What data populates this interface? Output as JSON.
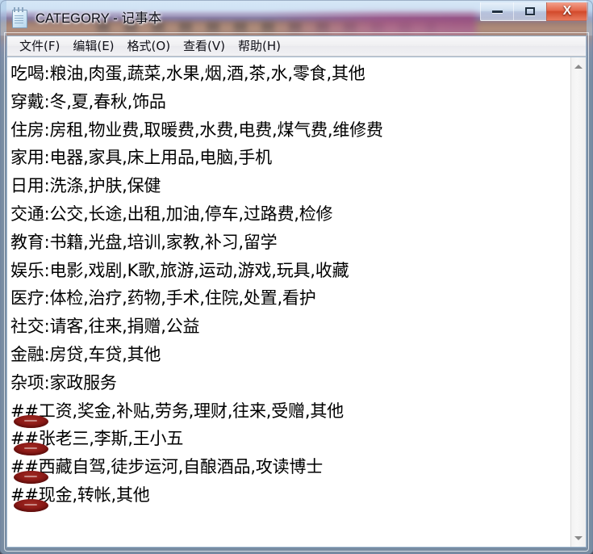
{
  "window": {
    "title": "CATEGORY - 记事本",
    "icon": "notepad-icon",
    "caption_buttons": {
      "minimize_label": "—",
      "maximize_label": "□",
      "close_label": "X"
    }
  },
  "menubar": {
    "items": [
      {
        "label": "文件(F)"
      },
      {
        "label": "编辑(E)"
      },
      {
        "label": "格式(O)"
      },
      {
        "label": "查看(V)"
      },
      {
        "label": "帮助(H)"
      }
    ]
  },
  "document": {
    "lines": [
      {
        "text": "吃喝:粮油,肉蛋,蔬菜,水果,烟,酒,茶,水,零食,其他",
        "annotated": false
      },
      {
        "text": "穿戴:冬,夏,春秋,饰品",
        "annotated": false
      },
      {
        "text": "住房:房租,物业费,取暖费,水费,电费,煤气费,维修费",
        "annotated": false
      },
      {
        "text": "家用:电器,家具,床上用品,电脑,手机",
        "annotated": false
      },
      {
        "text": "日用:洗涤,护肤,保健",
        "annotated": false
      },
      {
        "text": "交通:公交,长途,出租,加油,停车,过路费,检修",
        "annotated": false
      },
      {
        "text": "教育:书籍,光盘,培训,家教,补习,留学",
        "annotated": false
      },
      {
        "text": "娱乐:电影,戏剧,K歌,旅游,运动,游戏,玩具,收藏",
        "annotated": false
      },
      {
        "text": "医疗:体检,治疗,药物,手术,住院,处置,看护",
        "annotated": false
      },
      {
        "text": "社交:请客,往来,捐赠,公益",
        "annotated": false
      },
      {
        "text": "金融:房贷,车贷,其他",
        "annotated": false
      },
      {
        "text": "杂项:家政服务",
        "annotated": false
      },
      {
        "text": "##工资,奖金,补贴,劳务,理财,往来,受赠,其他",
        "annotated": true
      },
      {
        "text": "##张老三,李斯,王小五",
        "annotated": true
      },
      {
        "text": "##西藏自驾,徒步运河,自酿酒品,攻读博士",
        "annotated": true
      },
      {
        "text": "##现金,转帐,其他",
        "annotated": true
      }
    ]
  },
  "scrollbar": {
    "up_arrow": "scroll-up-arrow",
    "down_arrow": "scroll-down-arrow"
  },
  "colors": {
    "annotation_red": "#8c1a17",
    "close_button_red": "#d24a2b",
    "text_black": "#000000",
    "client_white": "#ffffff"
  }
}
